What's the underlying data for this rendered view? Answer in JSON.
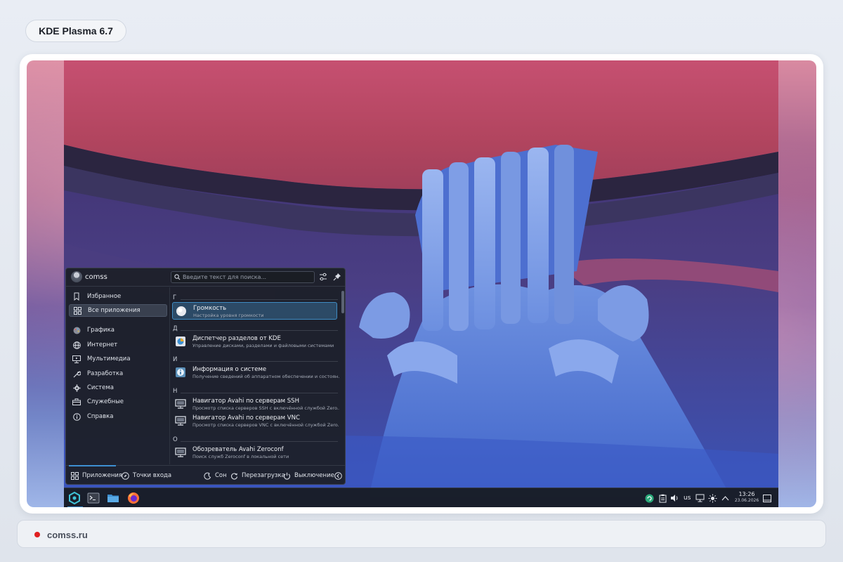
{
  "page": {
    "badge": "KDE Plasma 6.7",
    "source": "comss.ru"
  },
  "launcher": {
    "user_name": "comss",
    "search_placeholder": "Введите текст для поиска...",
    "sidebar": [
      {
        "label": "Избранное",
        "icon": "bookmark-icon",
        "active": false
      },
      {
        "label": "Все приложения",
        "icon": "grid-icon",
        "active": true
      },
      {
        "label": "Графика",
        "icon": "graphics-icon",
        "active": false
      },
      {
        "label": "Интернет",
        "icon": "globe-icon",
        "active": false
      },
      {
        "label": "Мультимедиа",
        "icon": "monitor-icon",
        "active": false
      },
      {
        "label": "Разработка",
        "icon": "wrench-icon",
        "active": false
      },
      {
        "label": "Система",
        "icon": "gear-icon",
        "active": false
      },
      {
        "label": "Служебные",
        "icon": "toolbox-icon",
        "active": false
      },
      {
        "label": "Справка",
        "icon": "info-icon",
        "active": false
      }
    ],
    "sections": [
      {
        "letter": "Г",
        "apps": [
          {
            "title": "Громкость",
            "desc": "Настройка уровня громкости",
            "icon": "volume-app-icon",
            "selected": true
          }
        ]
      },
      {
        "letter": "Д",
        "apps": [
          {
            "title": "Диспетчер разделов от KDE",
            "desc": "Управление дисками, разделами и файловыми системами",
            "icon": "partition-app-icon",
            "selected": false
          }
        ]
      },
      {
        "letter": "И",
        "apps": [
          {
            "title": "Информация о системе",
            "desc": "Получение сведений об аппаратном обеспечении и состоян...",
            "icon": "sysinfo-app-icon",
            "selected": false
          }
        ]
      },
      {
        "letter": "Н",
        "apps": [
          {
            "title": "Навигатор Avahi по серверам SSH",
            "desc": "Просмотр списка серверов SSH с включённой службой Zero...",
            "icon": "avahi-ssh-app-icon",
            "selected": false
          },
          {
            "title": "Навигатор Avahi по серверам VNC",
            "desc": "Просмотр списка серверов VNC с включённой службой Zero...",
            "icon": "avahi-vnc-app-icon",
            "selected": false
          }
        ]
      },
      {
        "letter": "О",
        "apps": [
          {
            "title": "Обозреватель Avahi Zeroconf",
            "desc": "Поиск служб Zeroconf в локальной сети",
            "icon": "avahi-browser-app-icon",
            "selected": false
          }
        ]
      }
    ],
    "footer": {
      "tab_apps": "Приложения",
      "tab_places": "Точки входа",
      "sleep": "Сон",
      "reboot": "Перезагрузка",
      "shutdown": "Выключение"
    }
  },
  "taskbar": {
    "tasks": [
      "plasma-launcher-icon",
      "terminal-icon",
      "folder-icon",
      "firefox-icon"
    ],
    "tray": [
      "kde-connect-icon",
      "clipboard-icon",
      "volume-icon",
      "network-icon",
      "brightness-icon",
      "chevron-up-icon"
    ],
    "keyboard_layout": "us",
    "clock_time": "13:26",
    "clock_date": "23.06.2026"
  },
  "colors": {
    "accent": "#3d8fd1",
    "panel_bg": "#1c2028",
    "wallpaper_top": "#c04a68",
    "ribbon": "#5a7fd6"
  }
}
